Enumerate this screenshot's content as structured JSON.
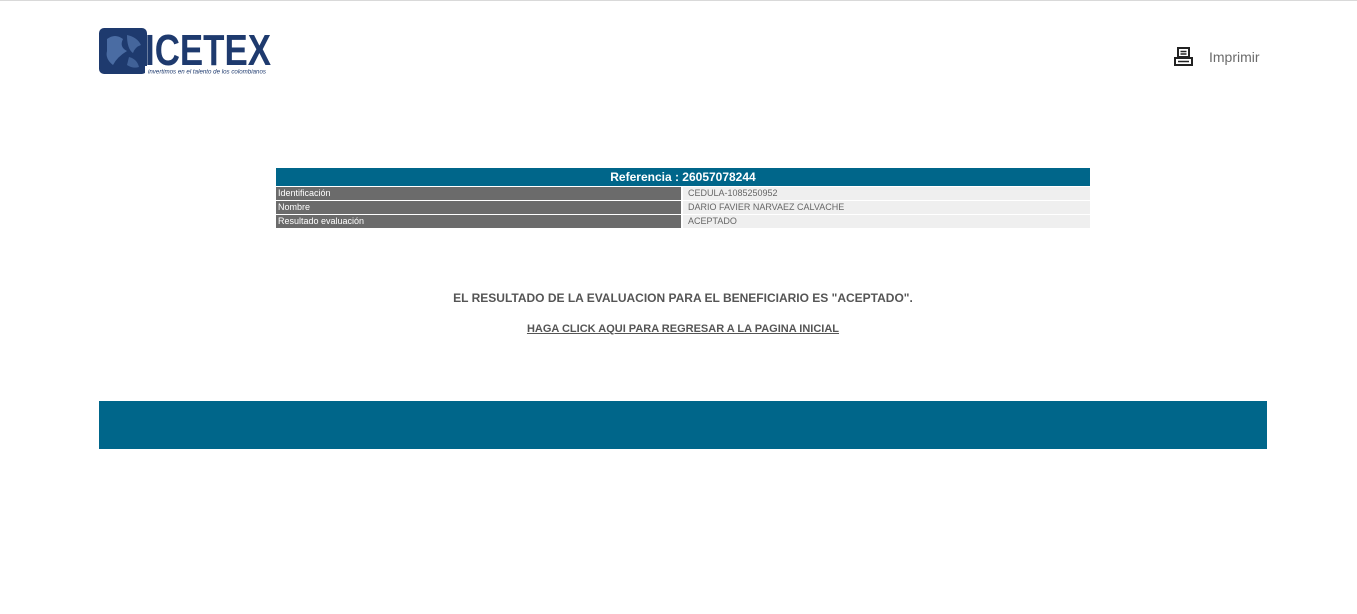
{
  "header": {
    "logo_text": "ICETEX",
    "logo_tagline": "invertimos en el talento de los colombianos",
    "print_label": "Imprimir",
    "print_icon": "printer-icon"
  },
  "reference": {
    "title": "Referencia : 26057078244",
    "rows": [
      {
        "label": "Identificación",
        "value": "CEDULA-1085250952"
      },
      {
        "label": "Nombre",
        "value": "DARIO FAVIER NARVAEZ CALVACHE"
      },
      {
        "label": "Resultado evaluación",
        "value": "ACEPTADO"
      }
    ]
  },
  "result": {
    "message": "EL RESULTADO DE LA EVALUACION PARA EL BENEFICIARIO ES \"ACEPTADO\".",
    "back_link": "HAGA CLICK AQUI PARA REGRESAR A LA PAGINA INICIAL"
  },
  "colors": {
    "brand_blue": "#00668a",
    "logo_navy": "#1e3a6e",
    "label_gray": "#6b6b6b"
  }
}
